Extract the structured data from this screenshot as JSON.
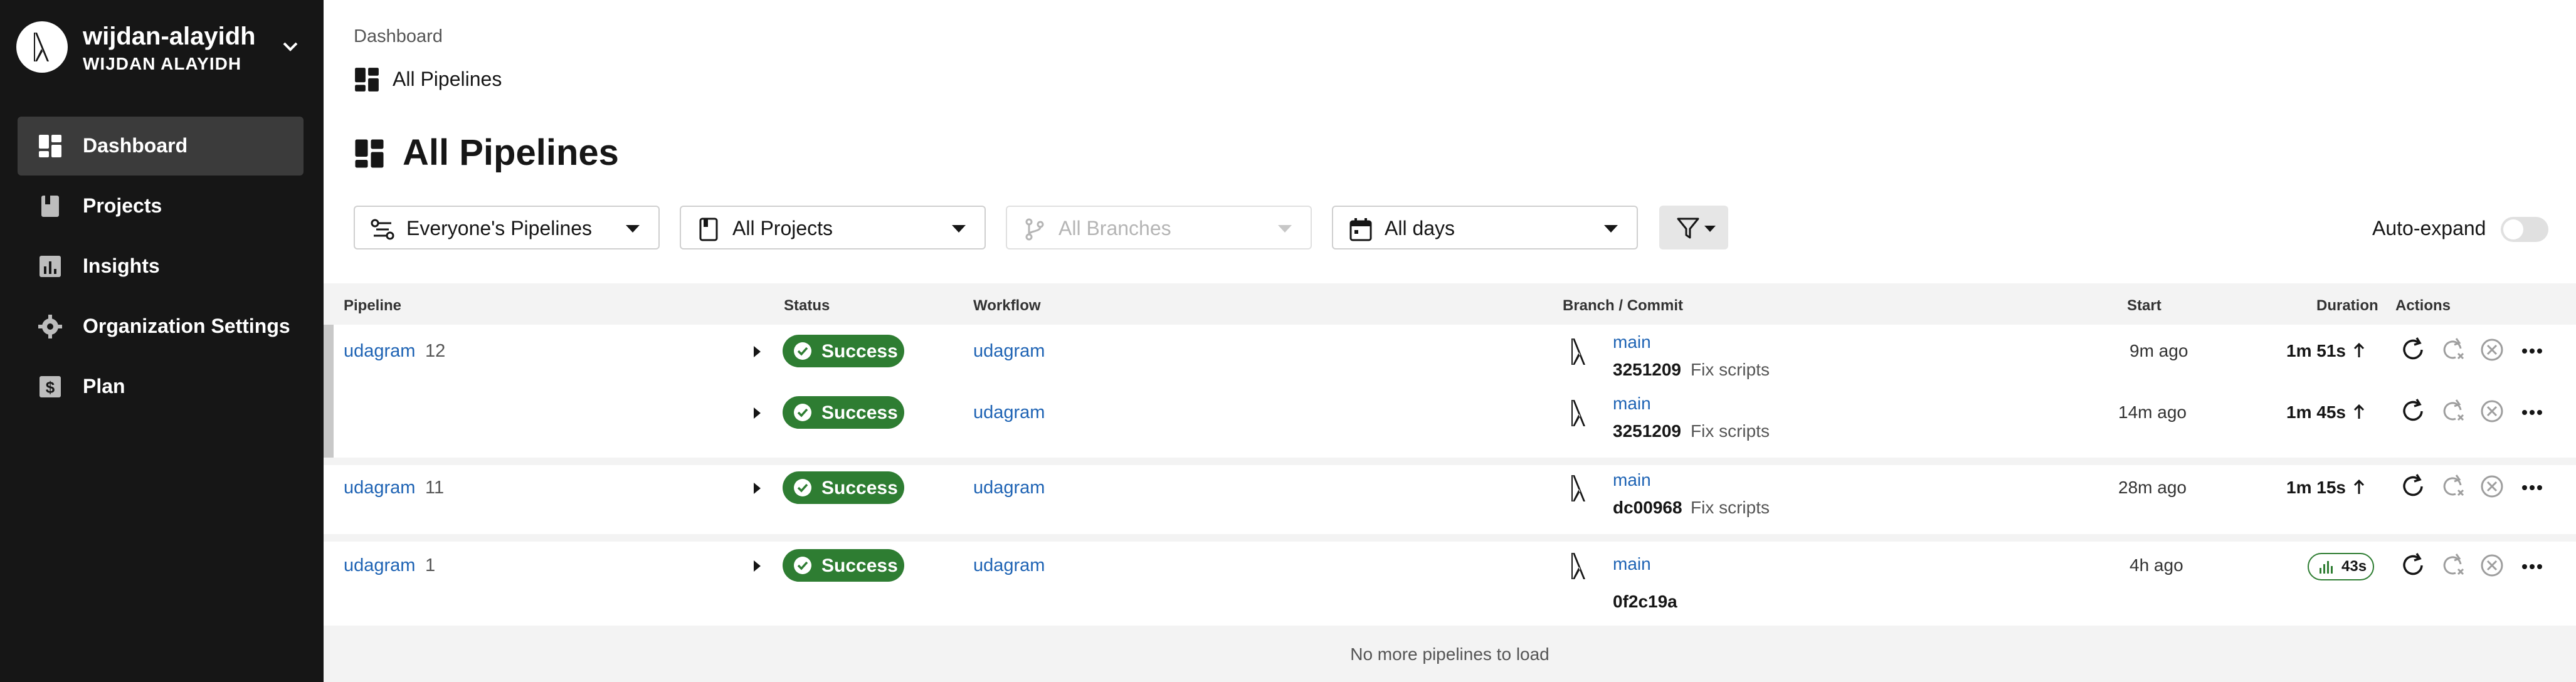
{
  "org": {
    "name": "wijdan-alayidh",
    "subtitle": "WIJDAN ALAYIDH"
  },
  "nav": [
    {
      "label": "Dashboard",
      "icon": "dashboard-icon",
      "active": true
    },
    {
      "label": "Projects",
      "icon": "book-icon",
      "active": false
    },
    {
      "label": "Insights",
      "icon": "chart-icon",
      "active": false
    },
    {
      "label": "Organization Settings",
      "icon": "gear-icon",
      "active": false
    },
    {
      "label": "Plan",
      "icon": "dollar-icon",
      "active": false
    }
  ],
  "breadcrumb": "Dashboard",
  "subtitle": "All Pipelines",
  "title": "All Pipelines",
  "filters": {
    "pipelines": "Everyone's Pipelines",
    "projects": "All Projects",
    "branches": "All Branches",
    "days": "All days",
    "auto_expand": "Auto-expand"
  },
  "columns": {
    "pipeline": "Pipeline",
    "status": "Status",
    "workflow": "Workflow",
    "branch_commit": "Branch / Commit",
    "start": "Start",
    "duration": "Duration",
    "actions": "Actions"
  },
  "rows": [
    {
      "project": "udagram",
      "number": "12",
      "status": "Success",
      "workflow": "udagram",
      "branch": "main",
      "sha": "3251209",
      "message": "Fix scripts",
      "start": "9m ago",
      "duration": "1m 51s"
    },
    {
      "project": "",
      "number": "",
      "status": "Success",
      "workflow": "udagram",
      "branch": "main",
      "sha": "3251209",
      "message": "Fix scripts",
      "start": "14m ago",
      "duration": "1m 45s"
    },
    {
      "project": "udagram",
      "number": "11",
      "status": "Success",
      "workflow": "udagram",
      "branch": "main",
      "sha": "dc00968",
      "message": "Fix scripts",
      "start": "28m ago",
      "duration": "1m 15s"
    },
    {
      "project": "udagram",
      "number": "1",
      "status": "Success",
      "workflow": "udagram",
      "branch": "main",
      "sha": "0f2c19a",
      "message": "",
      "start": "4h ago",
      "duration": "43s"
    }
  ],
  "footer": "No more pipelines to load",
  "colors": {
    "sidebar": "#161616",
    "success": "#2e7d32",
    "link": "#1e63b4"
  }
}
